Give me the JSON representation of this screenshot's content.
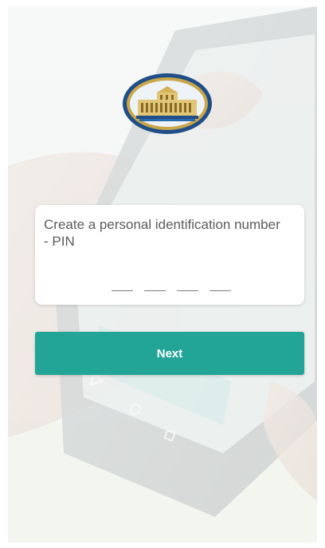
{
  "pin_prompt": {
    "title": "Create a personal identification number - PIN",
    "slots": 4
  },
  "actions": {
    "next_label": "Next"
  },
  "colors": {
    "accent": "#22a596",
    "logo_blue": "#1f4e88",
    "logo_gold": "#c9a64a"
  },
  "icons": {
    "logo": "bank-building-logo-icon"
  }
}
